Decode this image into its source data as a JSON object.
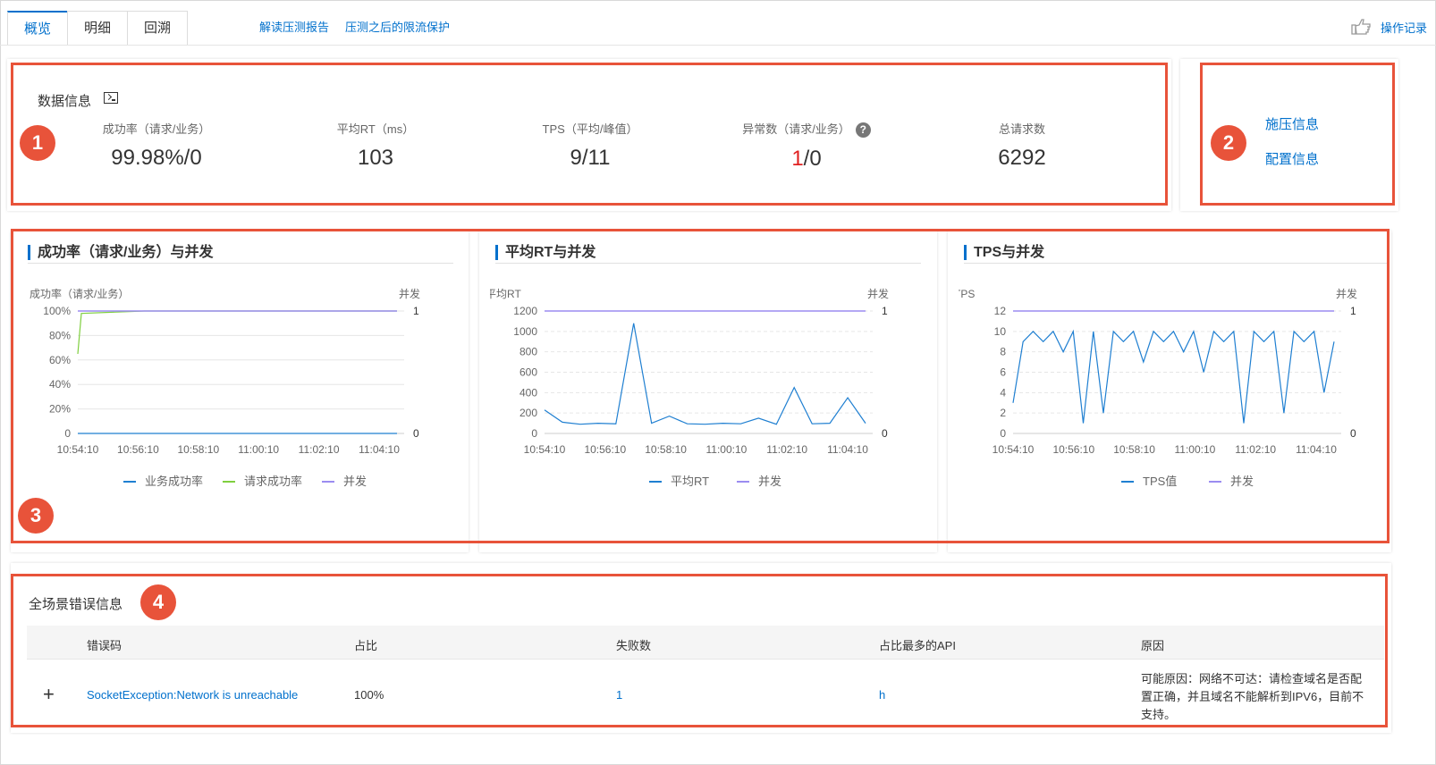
{
  "tabs": [
    {
      "label": "概览",
      "active": true
    },
    {
      "label": "明细",
      "active": false
    },
    {
      "label": "回溯",
      "active": false
    }
  ],
  "top_links": [
    "解读压测报告",
    "压测之后的限流保护"
  ],
  "op_record": "操作记录",
  "badges": [
    "1",
    "2",
    "3",
    "4"
  ],
  "data_info": {
    "title": "数据信息",
    "stats": [
      {
        "label": "成功率（请求/业务）",
        "value": "99.98%/0"
      },
      {
        "label": "平均RT（ms）",
        "value": "103"
      },
      {
        "label": "TPS（平均/峰值）",
        "value": "9/11"
      },
      {
        "label": "异常数（请求/业务）",
        "value_red": "1",
        "value_rest": "/0",
        "help": "?"
      },
      {
        "label": "总请求数",
        "value": "6292"
      }
    ]
  },
  "side_links": [
    "施压信息",
    "配置信息"
  ],
  "colors": {
    "accent": "#0070cc",
    "red": "#e8533a",
    "purple": "#9b8cf0",
    "green": "#7fcf3f",
    "series_blue": "#1f7fd1"
  },
  "charts": {
    "chart_data": [
      {
        "type": "line",
        "title": "成功率（请求/业务）与并发",
        "ylabel_left": "成功率（请求/业务）",
        "ylabel_right": "并发",
        "y_ticks_left": [
          "100%",
          "80%",
          "60%",
          "40%",
          "20%",
          "0"
        ],
        "y_ticks_right": [
          "1",
          "0"
        ],
        "x_ticks": [
          "10:54:10",
          "10:56:10",
          "10:58:10",
          "11:00:10",
          "11:02:10",
          "11:04:10"
        ],
        "legend": [
          "业务成功率",
          "请求成功率",
          "并发"
        ],
        "legend_position": "bottom",
        "series": [
          {
            "name": "业务成功率",
            "values": [
              0,
              0,
              0,
              0,
              0,
              0
            ]
          },
          {
            "name": "请求成功率",
            "values": [
              65,
              98,
              100,
              100,
              100,
              100,
              100
            ]
          },
          {
            "name": "并发",
            "values": [
              1,
              1,
              1,
              1,
              1,
              1
            ]
          }
        ]
      },
      {
        "type": "line",
        "title": "平均RT与并发",
        "ylabel_left": "平均RT",
        "ylabel_right": "并发",
        "y_ticks_left": [
          "1200",
          "1000",
          "800",
          "600",
          "400",
          "200",
          "0"
        ],
        "y_ticks_right": [
          "1",
          "0"
        ],
        "x_ticks": [
          "10:54:10",
          "10:56:10",
          "10:58:10",
          "11:00:10",
          "11:02:10",
          "11:04:10"
        ],
        "legend": [
          "平均RT",
          "并发"
        ],
        "legend_position": "bottom",
        "series": [
          {
            "name": "平均RT",
            "values": [
              230,
              110,
              90,
              100,
              95,
              1080,
              100,
              170,
              95,
              90,
              100,
              95,
              150,
              90,
              450,
              95,
              100,
              350,
              100
            ]
          },
          {
            "name": "并发",
            "values": [
              1,
              1,
              1,
              1,
              1,
              1
            ]
          }
        ]
      },
      {
        "type": "line",
        "title": "TPS与并发",
        "ylabel_left": "TPS",
        "ylabel_right": "并发",
        "y_ticks_left": [
          "12",
          "10",
          "8",
          "6",
          "4",
          "2",
          "0"
        ],
        "y_ticks_right": [
          "1",
          "0"
        ],
        "x_ticks": [
          "10:54:10",
          "10:56:10",
          "10:58:10",
          "11:00:10",
          "11:02:10",
          "11:04:10"
        ],
        "legend": [
          "TPS值",
          "并发"
        ],
        "legend_position": "bottom",
        "series": [
          {
            "name": "TPS值",
            "values": [
              3,
              9,
              10,
              9,
              10,
              8,
              10,
              1,
              10,
              2,
              10,
              9,
              10,
              7,
              10,
              9,
              10,
              8,
              10,
              6,
              10,
              9,
              10,
              1,
              10,
              9,
              10,
              2,
              10,
              9,
              10,
              4,
              9
            ]
          },
          {
            "name": "并发",
            "values": [
              1,
              1,
              1,
              1,
              1,
              1
            ]
          }
        ]
      }
    ]
  },
  "errors": {
    "title": "全场景错误信息",
    "columns": [
      "错误码",
      "占比",
      "失败数",
      "占比最多的API",
      "原因"
    ],
    "rows": [
      {
        "expand": "+",
        "code": "SocketException:Network is unreachable",
        "ratio": "100%",
        "fails": "1",
        "api": "h",
        "reason": "可能原因：网络不可达：请检查域名是否配置正确，并且域名不能解析到IPV6，目前不支持。"
      }
    ]
  }
}
